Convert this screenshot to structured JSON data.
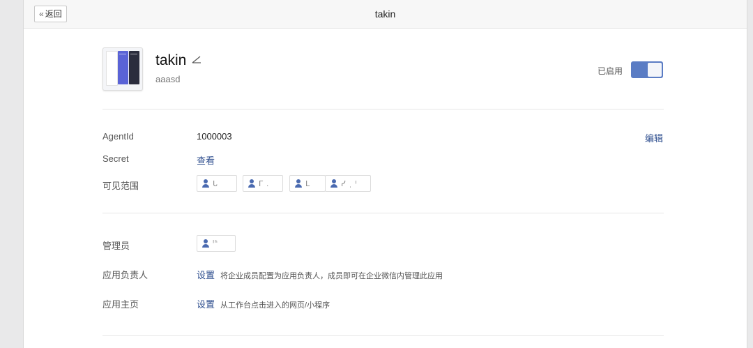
{
  "header": {
    "back_label": "返回",
    "title": "takin"
  },
  "app": {
    "name": "takin",
    "description": "aaasd",
    "status_label": "已启用",
    "enabled": true
  },
  "details": {
    "edit_label": "编辑",
    "agentid_label": "AgentId",
    "agentid_value": "1000003",
    "secret_label": "Secret",
    "secret_action": "查看",
    "visible_scope_label": "可见范围",
    "visible_members": [
      {
        "name": "ᒐ"
      },
      {
        "name": "ᒥ ."
      },
      {
        "name": "ᒪ"
      },
      {
        "name": "ᓯ ˌ ᑊ"
      }
    ]
  },
  "admin": {
    "admin_label": "管理员",
    "admin_member": "ᑊᑋ",
    "owner_label": "应用负责人",
    "owner_action": "设置",
    "owner_hint": "将企业成员配置为应用负责人，成员即可在企业微信内管理此应用",
    "homepage_label": "应用主页",
    "homepage_action": "设置",
    "homepage_hint": "从工作台点击进入的网页/小程序"
  }
}
